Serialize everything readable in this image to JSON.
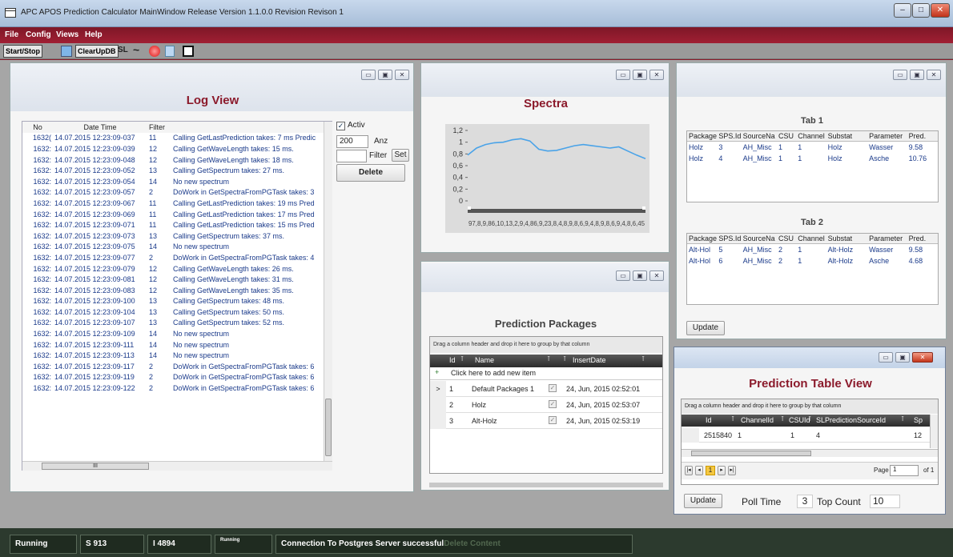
{
  "window": {
    "title": "APC APOS Prediction Calculator MainWindow   Release Version 1.1.0.0 Revision Revison 1",
    "controls": [
      "–",
      "□",
      "✕"
    ]
  },
  "menu": [
    "File",
    "Config",
    "Views",
    "Help"
  ],
  "toolbar": {
    "start_stop": "Start/Stop",
    "clear": "ClearUpDB",
    "sl": "SL",
    "wave": "~"
  },
  "log": {
    "title": "Log View",
    "headers": {
      "no": "No",
      "date": "Date Time",
      "filter": "Filter"
    },
    "rows": [
      {
        "no": "1632(",
        "dt": "14.07.2015 12:23:09-037",
        "f": "11",
        "msg": "Calling GetLastPrediction takes: 7 ms Predic"
      },
      {
        "no": "1632:",
        "dt": "14.07.2015 12:23:09-039",
        "f": "12",
        "msg": "Calling GetWaveLength takes: 15 ms."
      },
      {
        "no": "1632:",
        "dt": "14.07.2015 12:23:09-048",
        "f": "12",
        "msg": "Calling GetWaveLength takes: 18 ms."
      },
      {
        "no": "1632:",
        "dt": "14.07.2015 12:23:09-052",
        "f": "13",
        "msg": "Calling GetSpectrum takes: 27 ms."
      },
      {
        "no": "1632:",
        "dt": "14.07.2015 12:23:09-054",
        "f": "14",
        "msg": "No new spectrum"
      },
      {
        "no": "1632:",
        "dt": "14.07.2015 12:23:09-057",
        "f": "2",
        "msg": "DoWork in GetSpectraFromPGTask takes: 3"
      },
      {
        "no": "1632:",
        "dt": "14.07.2015 12:23:09-067",
        "f": "11",
        "msg": "Calling GetLastPrediction takes: 19 ms Pred"
      },
      {
        "no": "1632:",
        "dt": "14.07.2015 12:23:09-069",
        "f": "11",
        "msg": "Calling GetLastPrediction takes: 17 ms Pred"
      },
      {
        "no": "1632:",
        "dt": "14.07.2015 12:23:09-071",
        "f": "11",
        "msg": "Calling GetLastPrediction takes: 15 ms Pred"
      },
      {
        "no": "1632:",
        "dt": "14.07.2015 12:23:09-073",
        "f": "13",
        "msg": "Calling GetSpectrum takes: 37 ms."
      },
      {
        "no": "1632:",
        "dt": "14.07.2015 12:23:09-075",
        "f": "14",
        "msg": "No new spectrum"
      },
      {
        "no": "1632:",
        "dt": "14.07.2015 12:23:09-077",
        "f": "2",
        "msg": "DoWork in GetSpectraFromPGTask takes: 4"
      },
      {
        "no": "1632:",
        "dt": "14.07.2015 12:23:09-079",
        "f": "12",
        "msg": "Calling GetWaveLength takes: 26 ms."
      },
      {
        "no": "1632:",
        "dt": "14.07.2015 12:23:09-081",
        "f": "12",
        "msg": "Calling GetWaveLength takes: 31 ms."
      },
      {
        "no": "1632:",
        "dt": "14.07.2015 12:23:09-083",
        "f": "12",
        "msg": "Calling GetWaveLength takes: 35 ms."
      },
      {
        "no": "1632:",
        "dt": "14.07.2015 12:23:09-100",
        "f": "13",
        "msg": "Calling GetSpectrum takes: 48 ms."
      },
      {
        "no": "1632:",
        "dt": "14.07.2015 12:23:09-104",
        "f": "13",
        "msg": "Calling GetSpectrum takes: 50 ms."
      },
      {
        "no": "1632:",
        "dt": "14.07.2015 12:23:09-107",
        "f": "13",
        "msg": "Calling GetSpectrum takes: 52 ms."
      },
      {
        "no": "1632:",
        "dt": "14.07.2015 12:23:09-109",
        "f": "14",
        "msg": "No new spectrum"
      },
      {
        "no": "1632:",
        "dt": "14.07.2015 12:23:09-111",
        "f": "14",
        "msg": "No new spectrum"
      },
      {
        "no": "1632:",
        "dt": "14.07.2015 12:23:09-113",
        "f": "14",
        "msg": "No new spectrum"
      },
      {
        "no": "1632:",
        "dt": "14.07.2015 12:23:09-117",
        "f": "2",
        "msg": "DoWork in GetSpectraFromPGTask takes: 6"
      },
      {
        "no": "1632:",
        "dt": "14.07.2015 12:23:09-119",
        "f": "2",
        "msg": "DoWork in GetSpectraFromPGTask takes: 6"
      },
      {
        "no": "1632:",
        "dt": "14.07.2015 12:23:09-122",
        "f": "2",
        "msg": "DoWork in GetSpectraFromPGTask takes: 6"
      }
    ],
    "activ_label": "Activ",
    "anz_value": "200",
    "anz_label": "Anz",
    "filter_label": "Filter",
    "set_label": "Set",
    "delete_label": "Delete",
    "scroll_thumb": "III"
  },
  "spectra": {
    "title": "Spectra",
    "xaxis_labels": "97,8,9,86,10,13,2,9,4,86,9,23,8,4,8,9,8,6,9,4,8,9,8,6,9,4,8,6,45"
  },
  "chart_data": {
    "type": "line",
    "title": "Spectra",
    "xlabel": "",
    "ylabel": "",
    "ylim": [
      0,
      1.2
    ],
    "yticks": [
      "1,2",
      "1",
      "0,8",
      "0,6",
      "0,4",
      "0,2",
      "0"
    ],
    "x": [
      0,
      1,
      2,
      3,
      4,
      5,
      6,
      7,
      8,
      9,
      10,
      11,
      12,
      13,
      14,
      15,
      16,
      17,
      18,
      19,
      20
    ],
    "series": [
      {
        "values": [
          0.78,
          0.9,
          0.96,
          0.99,
          1.0,
          1.04,
          1.06,
          1.02,
          0.88,
          0.85,
          0.86,
          0.9,
          0.94,
          0.96,
          0.94,
          0.92,
          0.9,
          0.92,
          0.85,
          0.78,
          0.72
        ]
      }
    ]
  },
  "packages": {
    "title": "Prediction Packages",
    "group_hint": "Drag a column header and drop it here to group by that column",
    "headers": [
      "Id",
      "Name",
      "",
      "InsertDate"
    ],
    "add_row": "Click here to add new item",
    "rows": [
      {
        "id": "1",
        "name": "Default Packages 1",
        "date": "24, Jun, 2015 02:52:01"
      },
      {
        "id": "2",
        "name": "Holz",
        "date": "24, Jun, 2015 02:53:07"
      },
      {
        "id": "3",
        "name": "Alt-Holz",
        "date": "24, Jun, 2015 02:53:19"
      }
    ]
  },
  "tabs": {
    "tab1": "Tab 1",
    "tab2": "Tab 2",
    "headers": [
      "Package:",
      "SPS.Id",
      "SourceNa",
      "CSU",
      "Channel",
      "Substat",
      "Parameter",
      "Pred."
    ],
    "tab1_rows": [
      [
        "Holz",
        "3",
        "AH_Misc",
        "1",
        "1",
        "Holz",
        "Wasser",
        "9.58"
      ],
      [
        "Holz",
        "4",
        "AH_Misc",
        "1",
        "1",
        "Holz",
        "Asche",
        "10.76"
      ]
    ],
    "tab2_rows": [
      [
        "Alt-Hol",
        "5",
        "AH_Misc",
        "2",
        "1",
        "Alt-Holz",
        "Wasser",
        "9.58"
      ],
      [
        "Alt-Hol",
        "6",
        "AH_Misc",
        "2",
        "1",
        "Alt-Holz",
        "Asche",
        "4.68"
      ]
    ],
    "update": "Update"
  },
  "table_view": {
    "title": "Prediction Table View",
    "group_hint": "Drag a column header and drop it here to group by that column",
    "headers": [
      "Id",
      "ChannelId",
      "CSUId",
      "SLPredictionSourceId",
      "Sp"
    ],
    "row": [
      "2515840",
      "1",
      "1",
      "4",
      "12"
    ],
    "page_label": "Page",
    "page_value": "1",
    "of_label": "of 1",
    "pager_current": "1",
    "update": "Update",
    "poll_label": "Poll Time",
    "poll_value": "3",
    "top_label": "Top Count",
    "top_value": "10"
  },
  "status": {
    "running": "Running",
    "s": "S 913",
    "i": "I 4894",
    "mini": "Running",
    "conn": "Connection To Postgres Server successful",
    "ghost": "Delete Content"
  }
}
